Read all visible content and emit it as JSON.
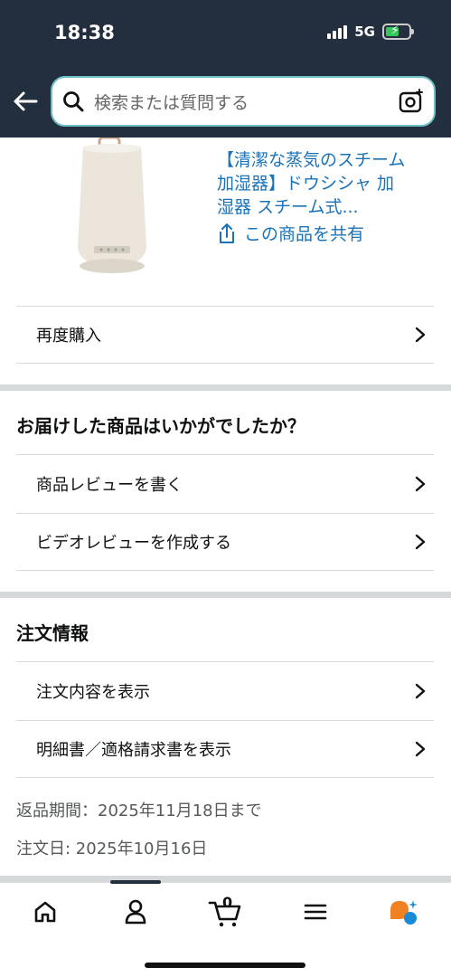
{
  "status": {
    "time": "18:38",
    "network": "5G"
  },
  "search": {
    "placeholder": "検索または質問する"
  },
  "product": {
    "title_line1": "【清潔な蒸気のスチーム",
    "title_line2": "加湿器】ドウシシャ 加",
    "title_line3": "湿器 スチーム式...",
    "share_label": "この商品を共有"
  },
  "rebuy": {
    "label": "再度購入"
  },
  "review_section": {
    "title": "お届けした商品はいかがでしたか？",
    "items": [
      {
        "label": "商品レビューを書く"
      },
      {
        "label": "ビデオレビューを作成する"
      }
    ]
  },
  "order_section": {
    "title": "注文情報",
    "items": [
      {
        "label": "注文内容を表示"
      },
      {
        "label": "明細書／適格請求書を表示"
      }
    ],
    "return_period": "返品期間：2025年11月18日まで",
    "order_date": "注文日: 2025年10月16日"
  },
  "bottom_nav": {
    "items": [
      "home-icon",
      "account-icon",
      "cart-icon",
      "menu-icon",
      "rufus-icon"
    ],
    "cart_count": "0"
  },
  "colors": {
    "header": "#232f3e",
    "link": "#1a73b8",
    "search_border": "#6fc1c5"
  }
}
